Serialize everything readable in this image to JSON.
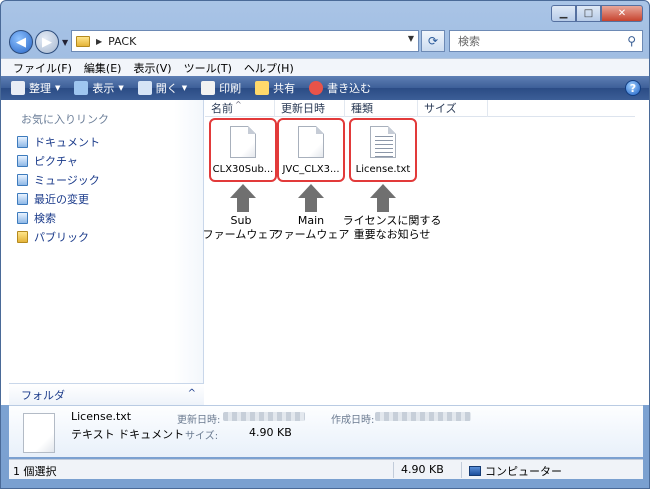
{
  "window": {
    "caption_buttons": {
      "minimize": "▁",
      "maximize": "□",
      "close": "✕"
    }
  },
  "address_bar": {
    "path": "PACK",
    "search_placeholder": "検索"
  },
  "menu": [
    "ファイル(F)",
    "編集(E)",
    "表示(V)",
    "ツール(T)",
    "ヘルプ(H)"
  ],
  "command_bar": [
    {
      "label": "整理",
      "icon": "organize-icon",
      "dropdown": true,
      "color": "#e9edf5"
    },
    {
      "label": "表示",
      "icon": "views-icon",
      "dropdown": true,
      "color": "#9fc6f0"
    },
    {
      "label": "開く",
      "icon": "open-icon",
      "dropdown": true,
      "color": "#d6e4f6"
    },
    {
      "label": "印刷",
      "icon": "print-icon",
      "dropdown": false,
      "color": "#f2f2f2"
    },
    {
      "label": "共有",
      "icon": "share-icon",
      "dropdown": false,
      "color": "#ffd96b"
    },
    {
      "label": "書き込む",
      "icon": "burn-icon",
      "dropdown": false,
      "color": "#e8534a"
    }
  ],
  "help_label": "?",
  "nav_pane": {
    "title": "お気に入りリンク",
    "items": [
      {
        "label": "ドキュメント",
        "icon": "documents-icon",
        "folder": false
      },
      {
        "label": "ピクチャ",
        "icon": "pictures-icon",
        "folder": false
      },
      {
        "label": "ミュージック",
        "icon": "music-icon",
        "folder": false
      },
      {
        "label": "最近の変更",
        "icon": "recent-icon",
        "folder": false
      },
      {
        "label": "検索",
        "icon": "searches-icon",
        "folder": false
      },
      {
        "label": "パブリック",
        "icon": "public-folder-icon",
        "folder": true
      }
    ],
    "folders_label": "フォルダ"
  },
  "columns": [
    "名前",
    "更新日時",
    "種類",
    "サイズ"
  ],
  "files": [
    {
      "name": "CLX30Sub...",
      "type": "plain"
    },
    {
      "name": "JVC_CLX3...",
      "type": "plain"
    },
    {
      "name": "License.txt",
      "type": "txt"
    }
  ],
  "annotations": [
    {
      "line1": "Sub",
      "line2": "ファームウェア"
    },
    {
      "line1": "Main",
      "line2": "ファームウェア"
    },
    {
      "line1": "ライセンスに関する",
      "line2": "重要なお知らせ"
    }
  ],
  "details": {
    "name": "License.txt",
    "type": "テキスト ドキュメント",
    "modified_label": "更新日時:",
    "created_label": "作成日時:",
    "size_label": "サイズ:",
    "size": "4.90 KB"
  },
  "status_bar": {
    "selection": "1 個選択",
    "size": "4.90 KB",
    "location": "コンピューター"
  }
}
